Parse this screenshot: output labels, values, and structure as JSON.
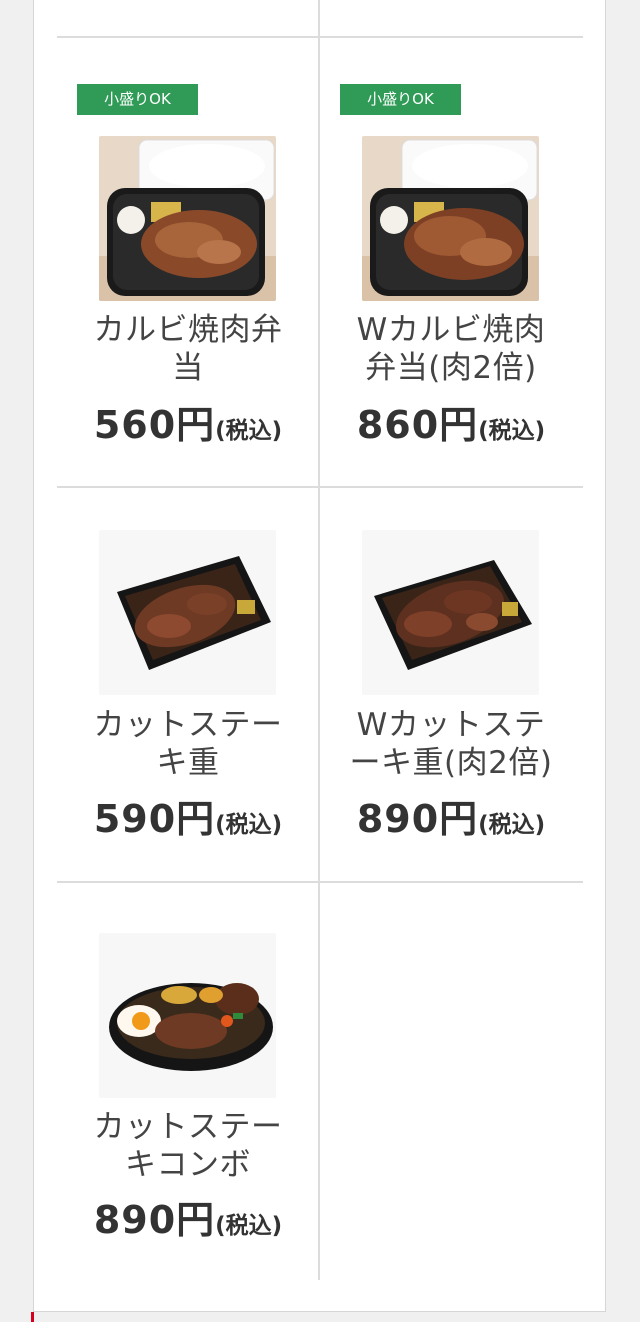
{
  "menu_items": [
    {
      "badge": "小盛りOK",
      "name_line1": "カルビ焼肉弁",
      "name_line2": "当",
      "price": "560円",
      "tax_note": "(税込)",
      "image": "karubi-yakiniku-bento-photo"
    },
    {
      "badge": "小盛りOK",
      "name_line1": "Wカルビ焼肉",
      "name_line2": "弁当(肉2倍)",
      "price": "860円",
      "tax_note": "(税込)",
      "image": "w-karubi-yakiniku-bento-photo"
    },
    {
      "name_line1": "カットステー",
      "name_line2": "キ重",
      "price": "590円",
      "tax_note": "(税込)",
      "image": "cut-steak-ju-photo"
    },
    {
      "name_line1": "Wカットステ",
      "name_line2": "ーキ重(肉2倍)",
      "price": "890円",
      "tax_note": "(税込)",
      "image": "w-cut-steak-ju-photo"
    },
    {
      "name_line1": "カットステー",
      "name_line2": "キコンボ",
      "price": "890円",
      "tax_note": "(税込)",
      "image": "cut-steak-combo-photo"
    }
  ],
  "colors": {
    "badge_green": "#2f9b57",
    "accent_red": "#d40020",
    "grid_line": "#dcdcdc"
  }
}
